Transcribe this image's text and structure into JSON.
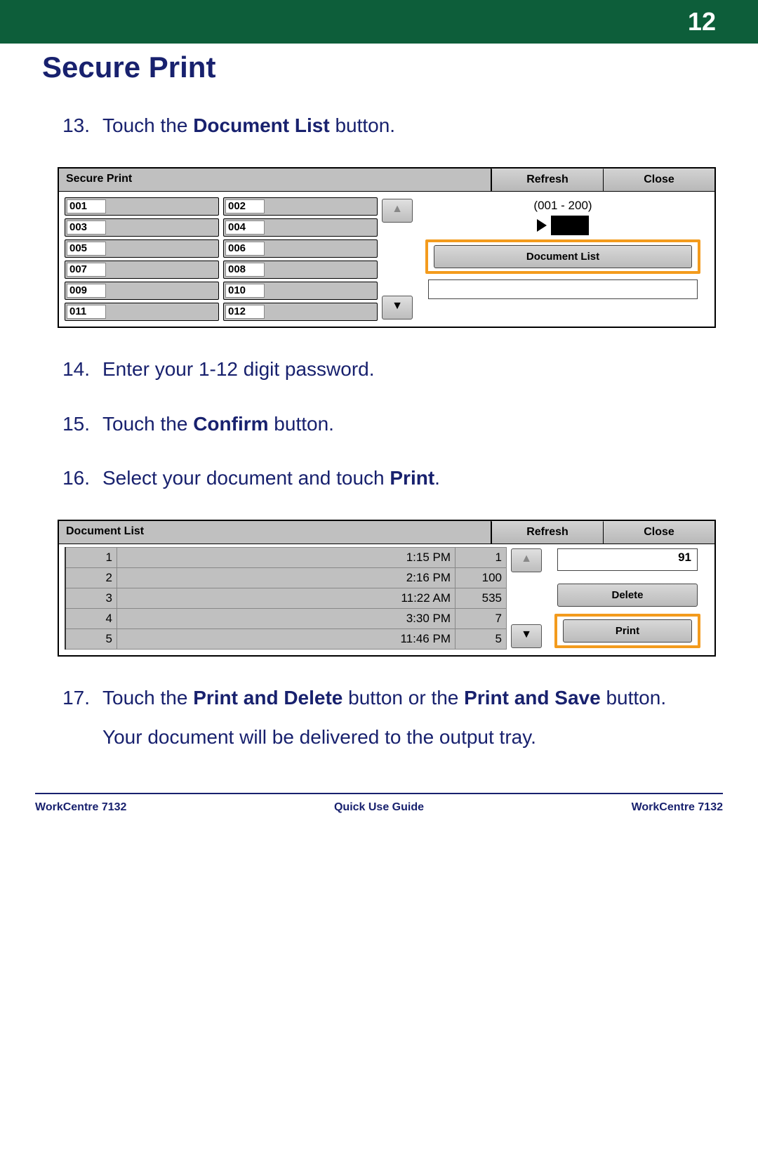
{
  "header": {
    "page_number": "12"
  },
  "heading": "Secure Print",
  "steps": {
    "s13": {
      "num": "13.",
      "pre": "Touch the ",
      "bold": "Document List",
      "post": " button."
    },
    "s14": {
      "num": "14.",
      "text": "Enter your 1-12 digit password."
    },
    "s15": {
      "num": "15.",
      "pre": "Touch the ",
      "bold": "Confirm",
      "post": " button."
    },
    "s16": {
      "num": "16.",
      "pre": "Select your document and touch ",
      "bold": "Print",
      "post": "."
    },
    "s17": {
      "num": "17.",
      "pre": "Touch the ",
      "bold1": "Print and Delete",
      "mid": " button or the ",
      "bold2": "Print and Save",
      "post": " button."
    },
    "s17b": {
      "text": "Your document will be delivered to the output tray."
    }
  },
  "screen1": {
    "title": "Secure Print",
    "refresh": "Refresh",
    "close": "Close",
    "left_items": [
      "001",
      "003",
      "005",
      "007",
      "009",
      "011"
    ],
    "right_items": [
      "002",
      "004",
      "006",
      "008",
      "010",
      "012"
    ],
    "range": "(001 - 200)",
    "doc_list_btn": "Document List"
  },
  "screen2": {
    "title": "Document List",
    "refresh": "Refresh",
    "close": "Close",
    "count": "91",
    "rows": [
      {
        "id": "1",
        "time": "1:15 PM",
        "qty": "1"
      },
      {
        "id": "2",
        "time": "2:16 PM",
        "qty": "100"
      },
      {
        "id": "3",
        "time": "11:22 AM",
        "qty": "535"
      },
      {
        "id": "4",
        "time": "3:30 PM",
        "qty": "7"
      },
      {
        "id": "5",
        "time": "11:46 PM",
        "qty": "5"
      }
    ],
    "delete_btn": "Delete",
    "print_btn": "Print"
  },
  "footer": {
    "left": "WorkCentre 7132",
    "center": "Quick Use Guide",
    "right": "WorkCentre 7132"
  }
}
